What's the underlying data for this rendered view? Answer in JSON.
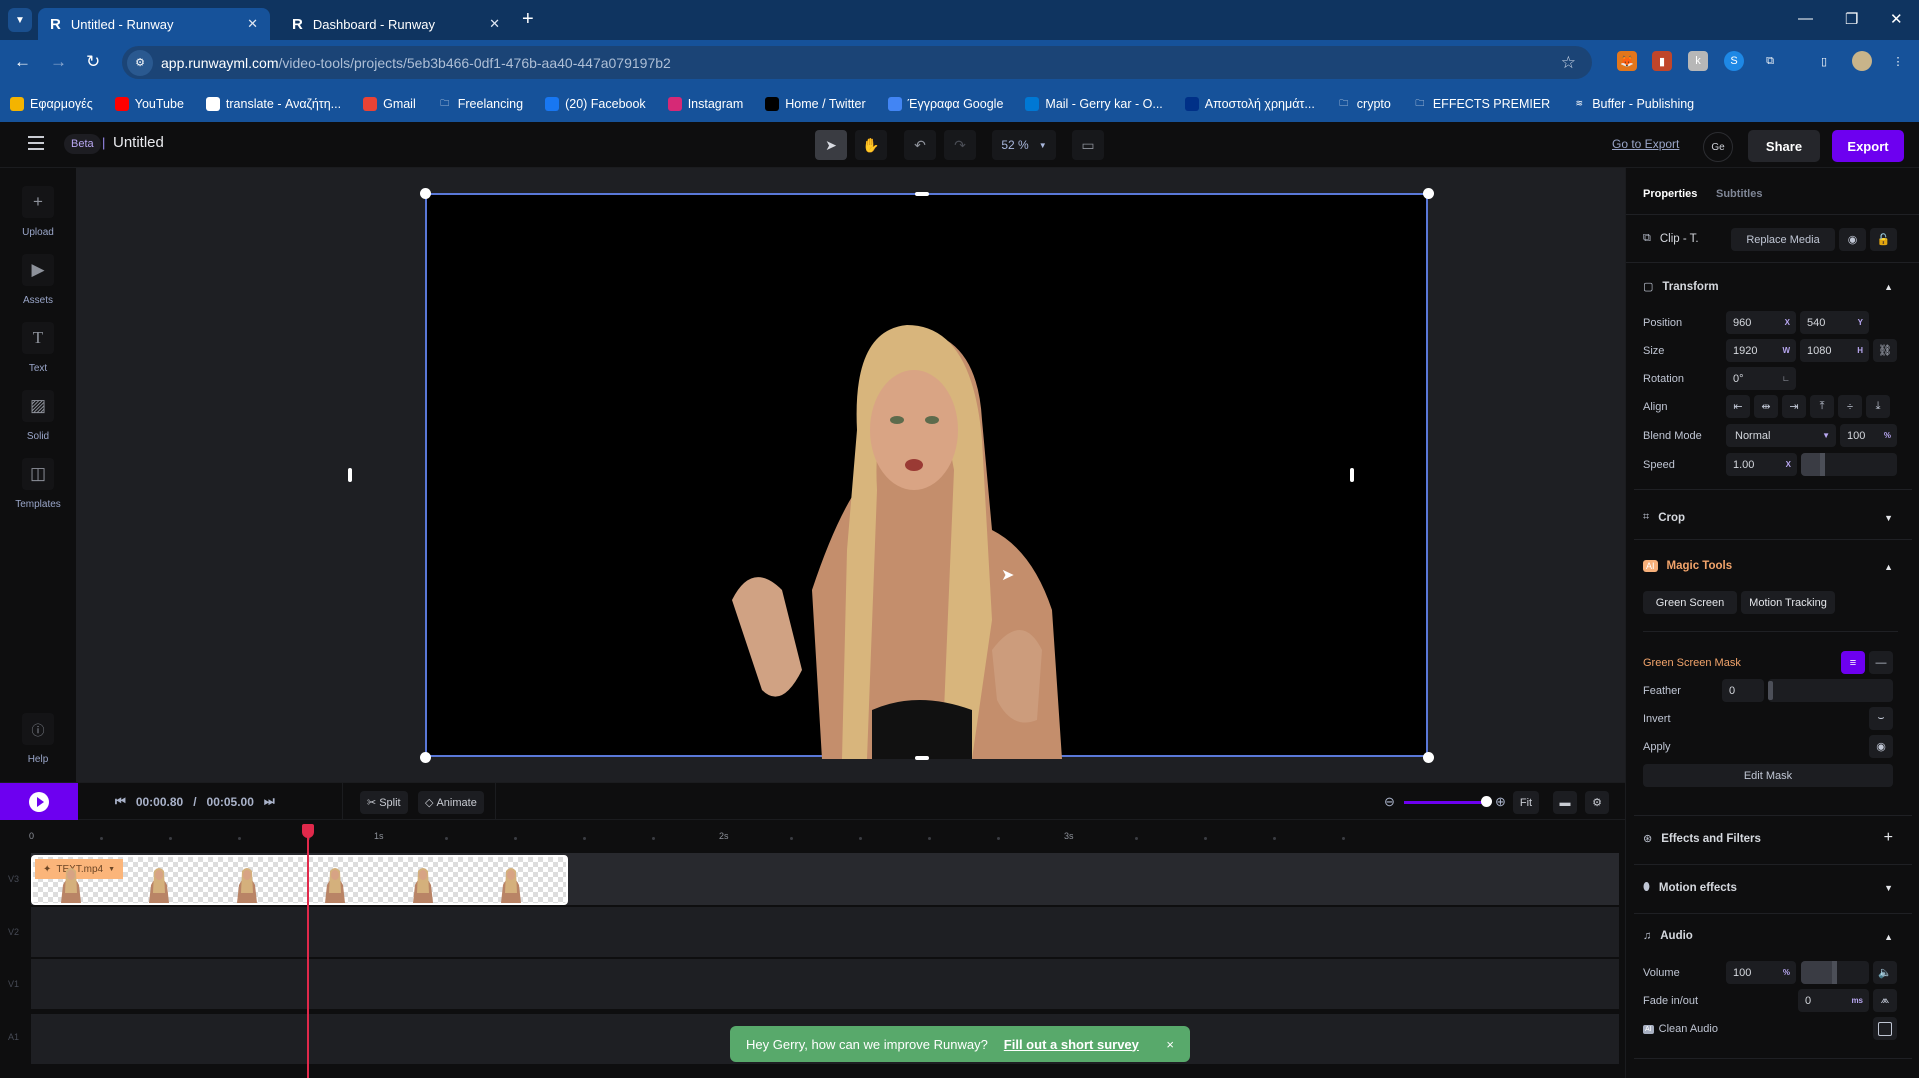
{
  "browser": {
    "tabs": [
      {
        "title": "Untitled - Runway",
        "active": true
      },
      {
        "title": "Dashboard - Runway",
        "active": false
      }
    ],
    "url_host": "app.runwayml.com",
    "url_path": "/video-tools/projects/5eb3b466-0df1-476b-aa40-447a079197b2",
    "bookmarks": [
      {
        "label": "Εφαρμογές",
        "icon": "apps-grid-icon",
        "color": "#f4b400"
      },
      {
        "label": "YouTube",
        "icon": "youtube-icon",
        "color": "#ff0000"
      },
      {
        "label": "translate - Αναζήτη...",
        "icon": "google-icon",
        "color": "#ffffff"
      },
      {
        "label": "Gmail",
        "icon": "gmail-icon",
        "color": "#ea4335"
      },
      {
        "label": "Freelancing",
        "icon": "folder-icon",
        "color": "transparent"
      },
      {
        "label": "(20) Facebook",
        "icon": "facebook-icon",
        "color": "#1877f2"
      },
      {
        "label": "Instagram",
        "icon": "instagram-icon",
        "color": "#d62976"
      },
      {
        "label": "Home / Twitter",
        "icon": "x-twitter-icon",
        "color": "#000000"
      },
      {
        "label": "Έγγραφα Google",
        "icon": "google-docs-icon",
        "color": "#4285f4"
      },
      {
        "label": "Mail - Gerry kar - O...",
        "icon": "outlook-icon",
        "color": "#0078d4"
      },
      {
        "label": "Αποστολή χρημάτ...",
        "icon": "paypal-icon",
        "color": "#003087"
      },
      {
        "label": "crypto",
        "icon": "folder-icon",
        "color": "transparent"
      },
      {
        "label": "EFFECTS PREMIER",
        "icon": "folder-icon",
        "color": "transparent"
      },
      {
        "label": "Buffer - Publishing",
        "icon": "buffer-icon",
        "color": "transparent"
      }
    ]
  },
  "app": {
    "beta_badge": "Beta",
    "project_title": "Untitled",
    "zoom_level": "52 %",
    "go_to_export": "Go to Export",
    "avatar_initials": "Ge",
    "share_label": "Share",
    "export_label": "Export",
    "accent": "#6d00f0"
  },
  "rail": [
    {
      "label": "Upload",
      "icon": "plus-icon"
    },
    {
      "label": "Assets",
      "icon": "folder-play-icon"
    },
    {
      "label": "Text",
      "icon": "text-t-icon"
    },
    {
      "label": "Solid",
      "icon": "hatched-square-icon"
    },
    {
      "label": "Templates",
      "icon": "layout-icon"
    }
  ],
  "help_label": "Help",
  "panel": {
    "tabs": [
      "Properties",
      "Subtitles"
    ],
    "clip_label": "Clip -  T.",
    "replace_media": "Replace Media",
    "transform": {
      "title": "Transform",
      "position_label": "Position",
      "pos_x": "960",
      "pos_y": "540",
      "size_label": "Size",
      "width": "1920",
      "height": "1080",
      "rotation_label": "Rotation",
      "rotation": "0°",
      "align_label": "Align",
      "blend_label": "Blend Mode",
      "blend_mode": "Normal",
      "opacity": "100",
      "speed_label": "Speed",
      "speed": "1.00"
    },
    "crop_title": "Crop",
    "magic": {
      "title": "Magic Tools",
      "ai_badge": "AI",
      "green_screen": "Green Screen",
      "motion_tracking": "Motion Tracking",
      "mask_title": "Green Screen Mask",
      "feather_label": "Feather",
      "feather": "0",
      "invert_label": "Invert",
      "apply_label": "Apply",
      "edit_mask": "Edit Mask"
    },
    "effects_title": "Effects and Filters",
    "motion_title": "Motion effects",
    "audio": {
      "title": "Audio",
      "volume_label": "Volume",
      "volume": "100",
      "fade_label": "Fade in/out",
      "fade": "0",
      "clean_audio": "Clean Audio",
      "ai_badge": "AI"
    }
  },
  "playback": {
    "current": "00:00.80",
    "separator": "/",
    "total": "00:05.00",
    "split": "Split",
    "animate": "Animate",
    "fit": "Fit",
    "timeline_zoom_fraction": 0.95
  },
  "timeline": {
    "ruler_labels": [
      "0",
      "1s",
      "2s",
      "3s"
    ],
    "tracks": [
      "V3",
      "V2",
      "V1",
      "A1"
    ],
    "clip_name": "TEXT.mp4",
    "playhead_seconds": 0.8
  },
  "toast": {
    "message": "Hey Gerry, how can we improve Runway?",
    "link": "Fill out a short survey",
    "close": "×"
  }
}
